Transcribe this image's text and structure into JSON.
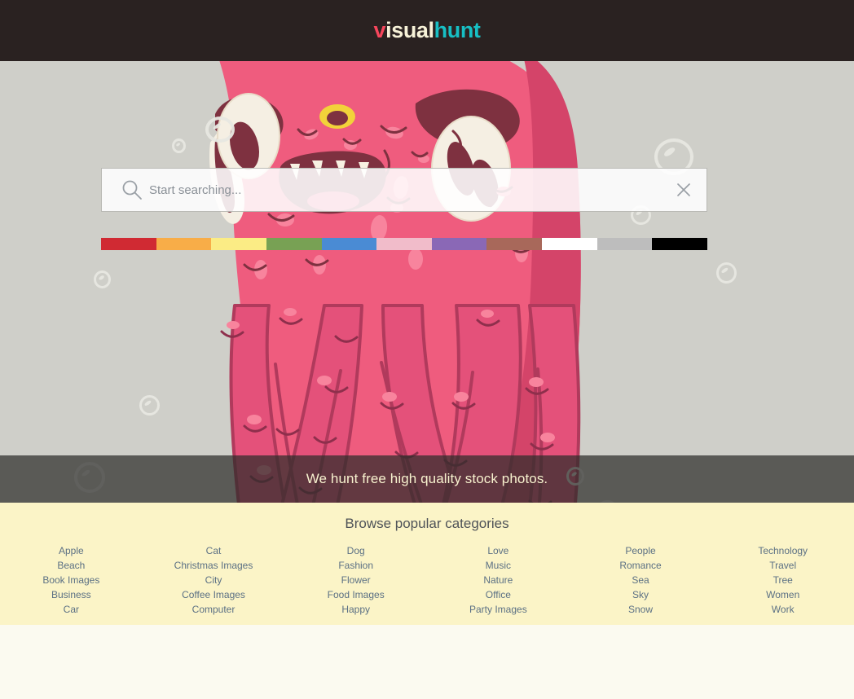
{
  "header": {
    "logo": {
      "part1": "v",
      "part2": "isual",
      "part3": "hunt"
    },
    "colors": {
      "background": "#2a2221",
      "v": "#f6465c",
      "isual": "#f7f2d8",
      "hunt": "#17bfc4"
    }
  },
  "hero": {
    "background_color": "#cfcfc9",
    "illustration": "pink-monster-illustration",
    "banner_text": "We hunt free high quality stock photos."
  },
  "search": {
    "placeholder": "Start searching...",
    "value": "",
    "search_icon": "magnifier-icon",
    "clear_icon": "close-x-icon"
  },
  "color_filters": [
    {
      "name": "red",
      "hex": "#d02a33"
    },
    {
      "name": "orange",
      "hex": "#f8ad48"
    },
    {
      "name": "yellow",
      "hex": "#fbec85"
    },
    {
      "name": "green",
      "hex": "#78a154"
    },
    {
      "name": "blue",
      "hex": "#4a8bd4"
    },
    {
      "name": "pink",
      "hex": "#f1bcca"
    },
    {
      "name": "purple",
      "hex": "#8a68b6"
    },
    {
      "name": "brown",
      "hex": "#a8685a"
    },
    {
      "name": "white",
      "hex": "#ffffff"
    },
    {
      "name": "gray",
      "hex": "#bdbdbd"
    },
    {
      "name": "black",
      "hex": "#000000"
    }
  ],
  "categories": {
    "title": "Browse popular categories",
    "background_color": "#fbf4c7",
    "link_color": "#5b7084",
    "columns": [
      {
        "items": [
          "Apple",
          "Beach",
          "Book Images",
          "Business",
          "Car"
        ]
      },
      {
        "items": [
          "Cat",
          "Christmas Images",
          "City",
          "Coffee Images",
          "Computer"
        ]
      },
      {
        "items": [
          "Dog",
          "Fashion",
          "Flower",
          "Food Images",
          "Happy"
        ]
      },
      {
        "items": [
          "Love",
          "Music",
          "Nature",
          "Office",
          "Party Images"
        ]
      },
      {
        "items": [
          "People",
          "Romance",
          "Sea",
          "Sky",
          "Snow"
        ]
      },
      {
        "items": [
          "Technology",
          "Travel",
          "Tree",
          "Women",
          "Work"
        ]
      }
    ]
  }
}
